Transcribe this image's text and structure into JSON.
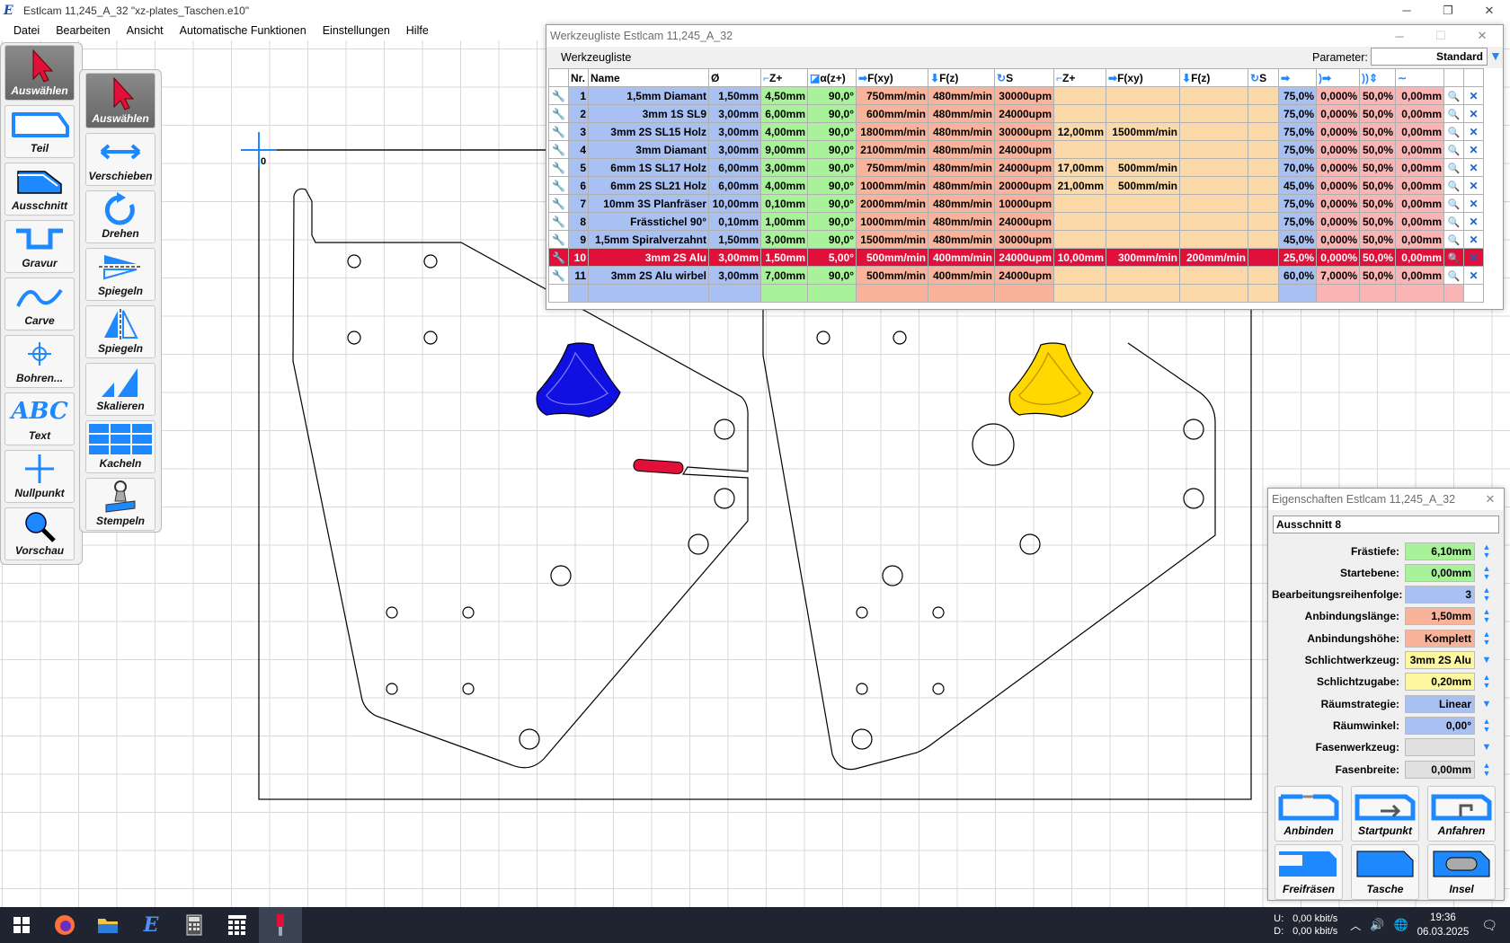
{
  "app": {
    "title": "Estlcam 11,245_A_32 \"xz-plates_Taschen.e10\"",
    "icon": "estlcam-icon"
  },
  "menu": [
    "Datei",
    "Bearbeiten",
    "Ansicht",
    "Automatische Funktionen",
    "Einstellungen",
    "Hilfe"
  ],
  "left_tools": [
    "Auswählen",
    "Teil",
    "Ausschnitt",
    "Gravur",
    "Carve",
    "Bohren...",
    "Text",
    "Nullpunkt",
    "Vorschau"
  ],
  "sub_tools": [
    "Auswählen",
    "Verschieben",
    "Drehen",
    "Spiegeln",
    "Spiegeln",
    "Skalieren",
    "Kacheln",
    "Stempeln"
  ],
  "canvas": {
    "origin_label": "0"
  },
  "tool_list": {
    "title": "Werkzeugliste Estlcam 11,245_A_32",
    "tab": "Werkzeugliste",
    "param_label": "Parameter:",
    "param_value": "Standard",
    "headers": [
      "Nr.",
      "Name",
      "Ø",
      "Z+",
      "α(z+)",
      "F(xy)",
      "F(z)",
      "S",
      "Z+",
      "F(xy)",
      "F(z)",
      "S"
    ],
    "rows": [
      [
        "1",
        "1,5mm Diamant",
        "1,50mm",
        "4,50mm",
        "90,0°",
        "750mm/min",
        "480mm/min",
        "30000upm",
        "",
        "",
        "",
        "",
        "75,0%",
        "0,000%",
        "50,0%",
        "0,00mm"
      ],
      [
        "2",
        "3mm 1S SL9",
        "3,00mm",
        "6,00mm",
        "90,0°",
        "600mm/min",
        "480mm/min",
        "24000upm",
        "",
        "",
        "",
        "",
        "75,0%",
        "0,000%",
        "50,0%",
        "0,00mm"
      ],
      [
        "3",
        "3mm 2S SL15 Holz",
        "3,00mm",
        "4,00mm",
        "90,0°",
        "1800mm/min",
        "480mm/min",
        "30000upm",
        "12,00mm",
        "1500mm/min",
        "",
        "",
        "75,0%",
        "0,000%",
        "50,0%",
        "0,00mm"
      ],
      [
        "4",
        "3mm Diamant",
        "3,00mm",
        "9,00mm",
        "90,0°",
        "2100mm/min",
        "480mm/min",
        "24000upm",
        "",
        "",
        "",
        "",
        "75,0%",
        "0,000%",
        "50,0%",
        "0,00mm"
      ],
      [
        "5",
        "6mm 1S SL17 Holz",
        "6,00mm",
        "3,00mm",
        "90,0°",
        "750mm/min",
        "480mm/min",
        "24000upm",
        "17,00mm",
        "500mm/min",
        "",
        "",
        "70,0%",
        "0,000%",
        "50,0%",
        "0,00mm"
      ],
      [
        "6",
        "6mm 2S SL21 Holz",
        "6,00mm",
        "4,00mm",
        "90,0°",
        "1000mm/min",
        "480mm/min",
        "20000upm",
        "21,00mm",
        "500mm/min",
        "",
        "",
        "45,0%",
        "0,000%",
        "50,0%",
        "0,00mm"
      ],
      [
        "7",
        "10mm 3S Planfräser",
        "10,00mm",
        "0,10mm",
        "90,0°",
        "2000mm/min",
        "480mm/min",
        "10000upm",
        "",
        "",
        "",
        "",
        "75,0%",
        "0,000%",
        "50,0%",
        "0,00mm"
      ],
      [
        "8",
        "Frässtichel 90°",
        "0,10mm",
        "1,00mm",
        "90,0°",
        "1000mm/min",
        "480mm/min",
        "24000upm",
        "",
        "",
        "",
        "",
        "75,0%",
        "0,000%",
        "50,0%",
        "0,00mm"
      ],
      [
        "9",
        "1,5mm Spiralverzahnt",
        "1,50mm",
        "3,00mm",
        "90,0°",
        "1500mm/min",
        "480mm/min",
        "30000upm",
        "",
        "",
        "",
        "",
        "45,0%",
        "0,000%",
        "50,0%",
        "0,00mm"
      ],
      [
        "10",
        "3mm 2S Alu",
        "3,00mm",
        "1,50mm",
        "5,00°",
        "500mm/min",
        "400mm/min",
        "24000upm",
        "10,00mm",
        "300mm/min",
        "200mm/min",
        "",
        "25,0%",
        "0,000%",
        "50,0%",
        "0,00mm"
      ],
      [
        "11",
        "3mm 2S Alu wirbel",
        "3,00mm",
        "7,00mm",
        "90,0°",
        "500mm/min",
        "400mm/min",
        "24000upm",
        "",
        "",
        "",
        "",
        "60,0%",
        "7,000%",
        "50,0%",
        "0,00mm"
      ]
    ],
    "selected_row": 9
  },
  "props": {
    "title": "Eigenschaften Estlcam 11,245_A_32",
    "name": "Ausschnitt 8",
    "fields": [
      {
        "label": "Frästiefe:",
        "value": "6,10mm",
        "color": "#a8f29a",
        "ctrl": "spin"
      },
      {
        "label": "Startebene:",
        "value": "0,00mm",
        "color": "#a8f29a",
        "ctrl": "spin"
      },
      {
        "label": "Bearbeitungsreihenfolge:",
        "value": "3",
        "color": "#a9c0f3",
        "ctrl": "spin"
      },
      {
        "label": "Anbindungslänge:",
        "value": "1,50mm",
        "color": "#f9b39b",
        "ctrl": "spin"
      },
      {
        "label": "Anbindungshöhe:",
        "value": "Komplett",
        "color": "#f9b39b",
        "ctrl": "spin"
      },
      {
        "label": "Schlichtwerkzeug:",
        "value": "3mm 2S Alu",
        "color": "#fdf7a0",
        "ctrl": "drop"
      },
      {
        "label": "Schlichtzugabe:",
        "value": "0,20mm",
        "color": "#fdf7a0",
        "ctrl": "spin"
      },
      {
        "label": "Räumstrategie:",
        "value": "Linear",
        "color": "#a9c0f3",
        "ctrl": "drop"
      },
      {
        "label": "Räumwinkel:",
        "value": "0,00°",
        "color": "#a9c0f3",
        "ctrl": "spin"
      },
      {
        "label": "Fasenwerkzeug:",
        "value": "",
        "color": "#e0e0e0",
        "ctrl": "drop"
      },
      {
        "label": "Fasenbreite:",
        "value": "0,00mm",
        "color": "#e0e0e0",
        "ctrl": "spin"
      }
    ],
    "buttons": [
      "Anbinden",
      "Startpunkt",
      "Anfahren",
      "Freifräsen",
      "Tasche",
      "Insel"
    ]
  },
  "taskbar": {
    "net_up_label": "U:",
    "net_down_label": "D:",
    "net_up": "0,00 kbit/s",
    "net_down": "0,00 kbit/s",
    "time": "19:36",
    "date": "06.03.2025"
  },
  "colors": {
    "accent": "#1e88ff",
    "selected_row": "#e0103a",
    "pocket_blue": "#1010e0",
    "pocket_yellow": "#ffd800",
    "pocket_red": "#e0103a"
  }
}
